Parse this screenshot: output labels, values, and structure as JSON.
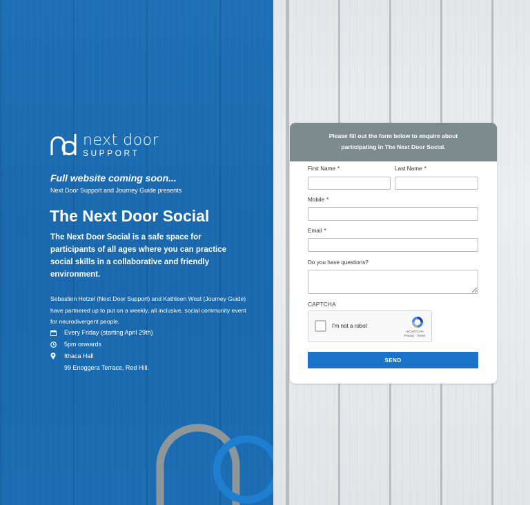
{
  "brand": {
    "logo_top": "next door",
    "logo_bottom": "SUPPORT"
  },
  "hero": {
    "coming_soon": "Full website coming soon...",
    "presents": "Next Door Support and Journey Guide presents",
    "title": "The Next Door Social",
    "intro": "The Next Door Social is a safe space for participants of all ages where you can practice social skills in a collaborative and friendly environment.",
    "description": "Sebastien Hetzel (Next Door Support) and Kathleen West (Journey Guide) have partnered up to put on a weekly, all inclusive, social community event for neurodivergent people."
  },
  "event": {
    "when": "Every Friday (starting April 29th)",
    "time": "5pm onwards",
    "venue": "Ithaca Hall",
    "address": "99 Enoggera Terrace, Red Hill."
  },
  "form": {
    "heading": "Please fill out the form below to enquire about participating in The Next Door Social.",
    "first_name_label": "First Name",
    "last_name_label": "Last Name",
    "mobile_label": "Mobile",
    "email_label": "Email",
    "questions_label": "Do you have questions?",
    "required_mark": "*",
    "captcha_label": "CAPTCHA",
    "captcha_text": "I'm not a robot",
    "captcha_brand": "reCAPTCHA",
    "captcha_links": "Privacy - Terms",
    "send_label": "SEND"
  },
  "colors": {
    "left_panel": "#1b6cb2",
    "form_header": "#7d8a8e",
    "send_button": "#1a73c9"
  }
}
